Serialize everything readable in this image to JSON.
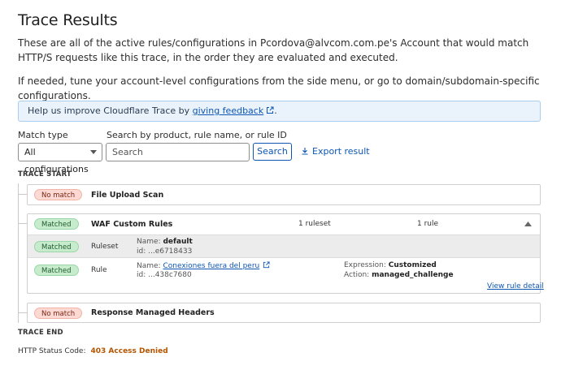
{
  "page": {
    "title": "Trace Results",
    "intro_line1": "These are all of the active rules/configurations in Pcordova@alvcom.com.pe's Account that would match HTTP/S requests like this trace, in the order they are evaluated and executed.",
    "intro_line2": "If needed, tune your account-level configurations from the side menu, or go to domain/subdomain-specific configurations."
  },
  "banner": {
    "text": "Help us improve Cloudflare Trace by ",
    "link_text": "giving feedback",
    "suffix": "."
  },
  "filters": {
    "match_type_label": "Match type",
    "match_type_value": "All configurations",
    "search_label": "Search by product, rule name, or rule ID",
    "search_placeholder": "Search",
    "search_button": "Search",
    "export_label": "Export result"
  },
  "trace": {
    "start_label": "TRACE START",
    "end_label": "TRACE END",
    "items": [
      {
        "status": "No match",
        "title": "File Upload Scan"
      },
      {
        "status": "Matched",
        "title": "WAF Custom Rules",
        "ruleset_count": "1 ruleset",
        "rule_count": "1 rule",
        "ruleset_row": {
          "status": "Matched",
          "kind": "Ruleset",
          "name_label": "Name:",
          "name_value": "default",
          "id_text": "id: ...e6718433"
        },
        "rule_row": {
          "status": "Matched",
          "kind": "Rule",
          "name_label": "Name:",
          "name_value": "Conexiones fuera del peru",
          "id_text": "id: ...438c7680",
          "expression_label": "Expression:",
          "expression_value": "Customized",
          "action_label": "Action:",
          "action_value": "managed_challenge",
          "view_detail": "View rule detail"
        }
      },
      {
        "status": "No match",
        "title": "Response Managed Headers"
      }
    ]
  },
  "status": {
    "label": "HTTP Status Code:",
    "value": "403 Access Denied"
  },
  "colors": {
    "link": "#0d56b3",
    "no_match_bg": "#fcd9d3",
    "matched_bg": "#c7eccd",
    "status_code": "#b35400"
  }
}
